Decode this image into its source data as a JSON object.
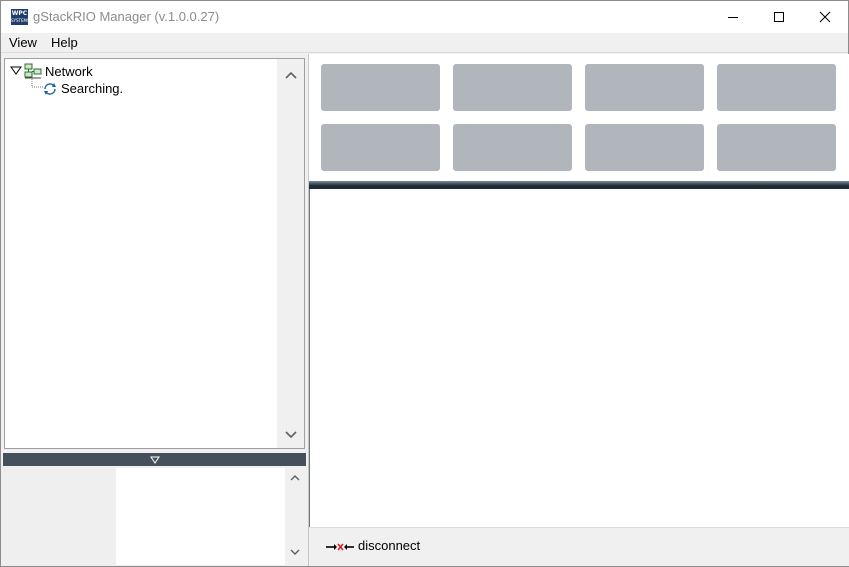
{
  "window": {
    "title": "gStackRIO Manager (v.1.0.0.27)",
    "icon_text_top": "WPC",
    "icon_text_bottom": "SYSTEMS"
  },
  "menu": {
    "items": [
      {
        "label": "View"
      },
      {
        "label": "Help"
      }
    ]
  },
  "tree": {
    "root_label": "Network",
    "child_label": "Searching."
  },
  "status": {
    "connection_label": "disconnect",
    "disconnect_color": "#e81123"
  },
  "colors": {
    "tile": "#b1b6bd",
    "splitter": "#45505c",
    "divider": "#1d2b36"
  },
  "icons": {
    "network": "network-computers-icon",
    "searching": "refresh-icon",
    "disconnect": "disconnect-icon"
  }
}
